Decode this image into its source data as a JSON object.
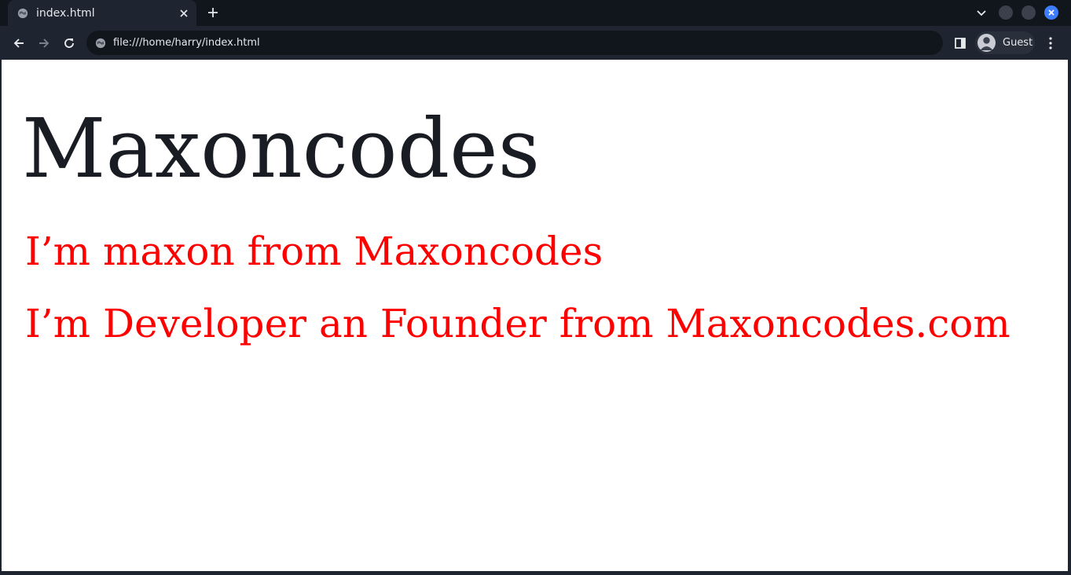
{
  "browser": {
    "tab": {
      "title": "index.html",
      "icon": "globe-icon"
    },
    "address_bar": {
      "url": "file:///home/harry/index.html"
    },
    "profile": {
      "label": "Guest"
    },
    "colors": {
      "chrome": "#1f2530",
      "tabstrip": "#11151c",
      "close_accent": "#3d7eff"
    }
  },
  "page": {
    "heading": "Maxoncodes",
    "paragraphs": [
      "I’m maxon from Maxoncodes",
      "I’m Developer an Founder from Maxoncodes.com"
    ],
    "colors": {
      "heading": "#1a1c24",
      "paragraph": "#ff0000"
    }
  }
}
